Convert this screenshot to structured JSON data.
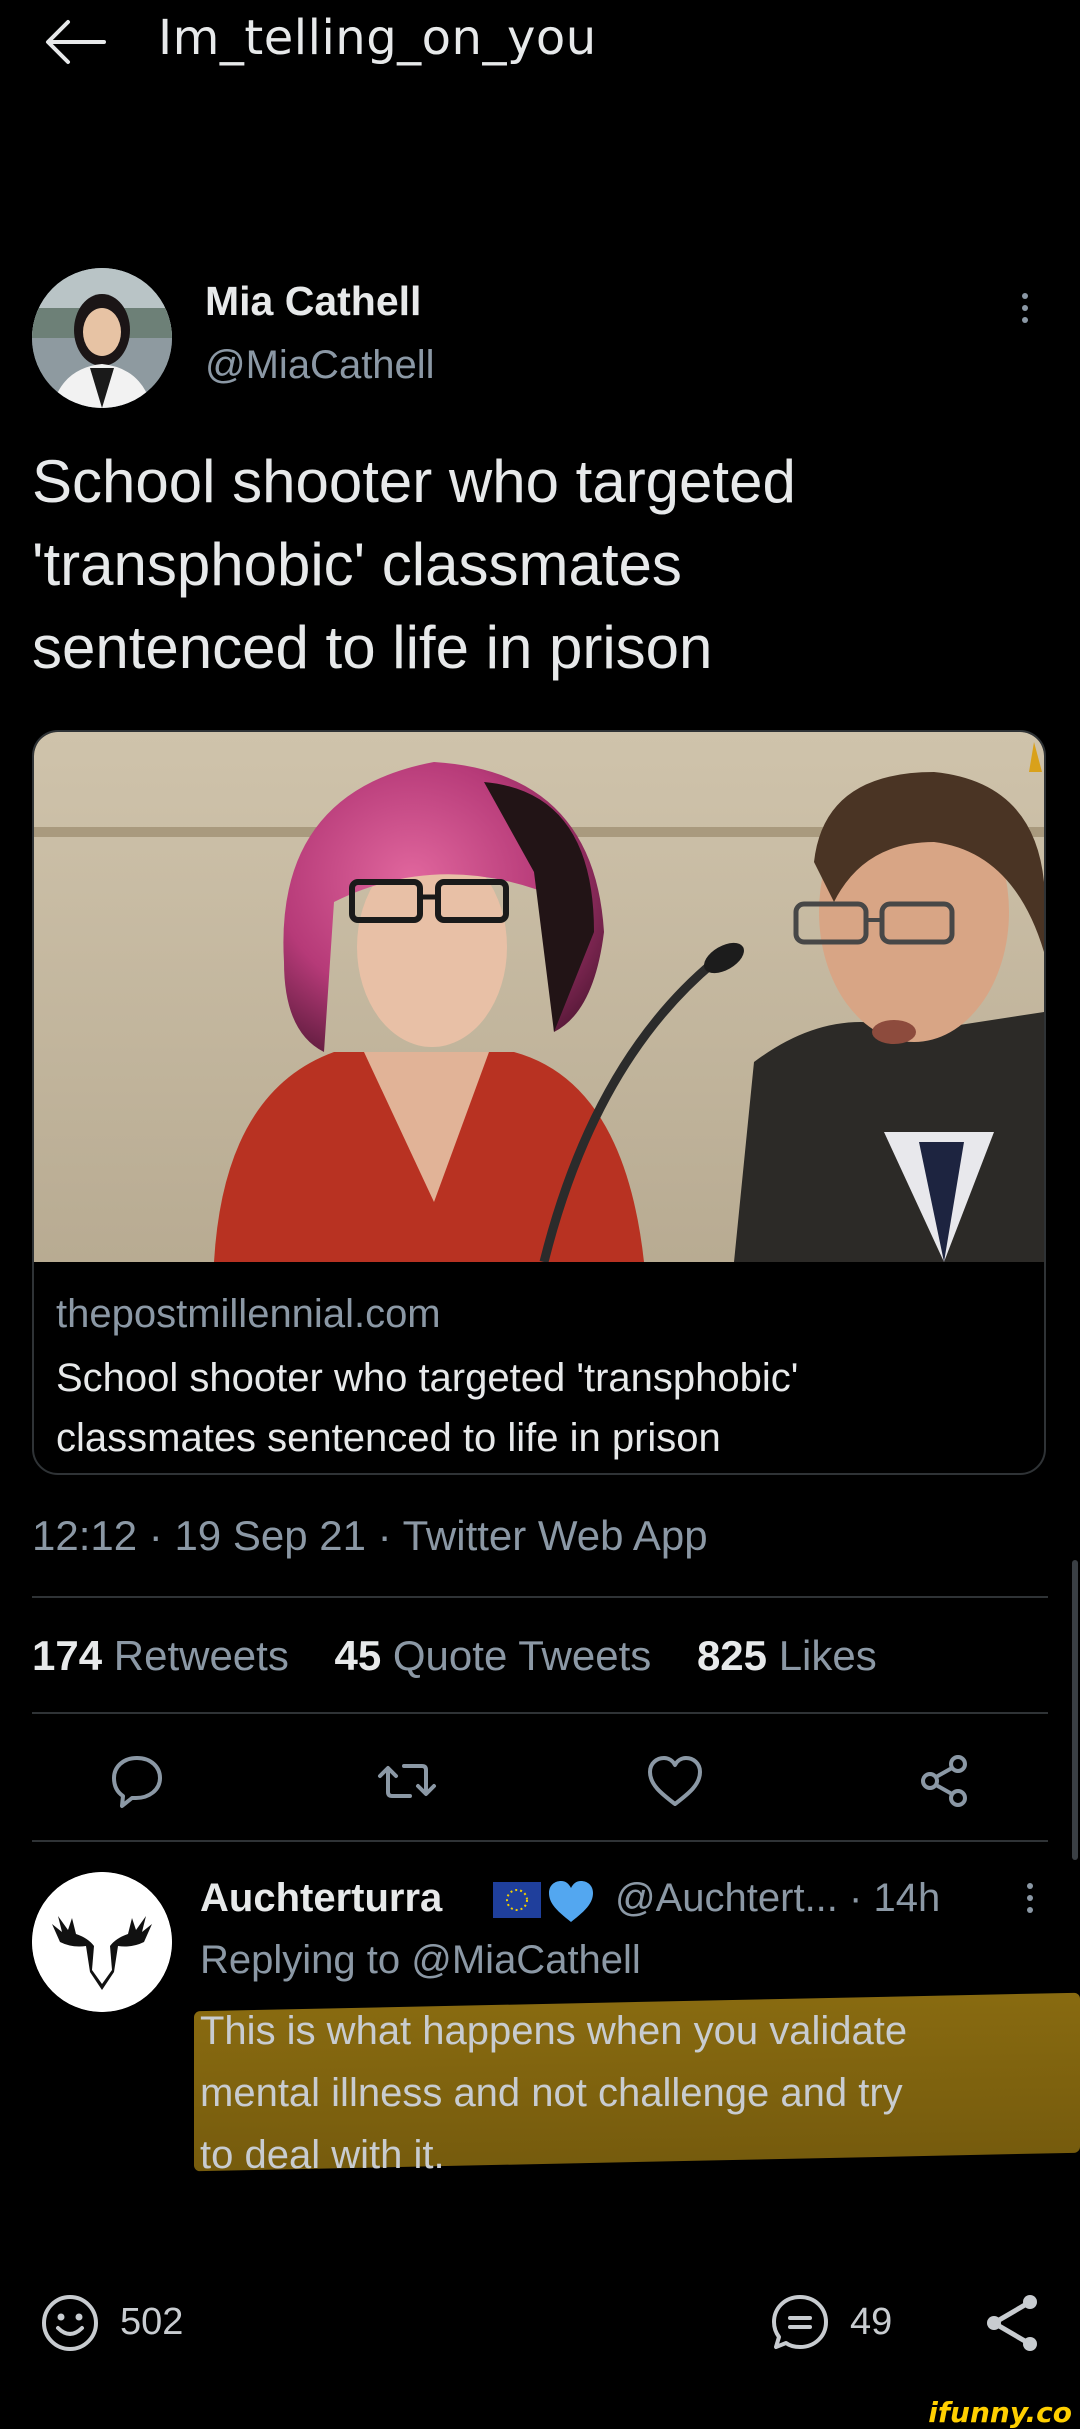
{
  "header": {
    "title": "Im_telling_on_you"
  },
  "tweet": {
    "author_name": "Mia Cathell",
    "author_handle": "@MiaCathell",
    "text_lines": [
      "School shooter who targeted",
      "'transphobic' classmates",
      "sentenced to life in prison"
    ],
    "card": {
      "domain": "thepostmillennial.com",
      "title_lines": [
        "School shooter who targeted 'transphobic'",
        "classmates sentenced to life in prison"
      ]
    },
    "time": "12:12",
    "date": "19 Sep 21",
    "app": "Twitter Web App",
    "separator": "·",
    "stats": {
      "retweets_count": "174",
      "retweets_label": "Retweets",
      "quotes_count": "45",
      "quotes_label": "Quote Tweets",
      "likes_count": "825",
      "likes_label": "Likes"
    },
    "actions": [
      "reply-icon",
      "retweet-icon",
      "like-icon",
      "share-icon"
    ]
  },
  "reply": {
    "author_name": "Auchterturra",
    "badges": [
      "eu-flag-icon",
      "blue-heart-icon"
    ],
    "meta": "@Auchtert... · 14h",
    "replying_prefix": "Replying to",
    "replying_handle": "@MiaCathell",
    "text_lines": [
      "This is what happens when you validate",
      "mental illness and not challenge and try",
      "to deal with it."
    ],
    "highlight_color": "#9a7612"
  },
  "bottom_bar": {
    "smiles_count": "502",
    "comments_count": "49",
    "icons": [
      "smiley-icon",
      "comment-icon",
      "share-icon"
    ]
  },
  "watermark": "ifunny.co",
  "colors": {
    "background": "#000000",
    "text_primary": "#e7e9ea",
    "text_secondary": "#8b98a5",
    "divider": "#2f3336",
    "watermark": "#ffcf00"
  }
}
